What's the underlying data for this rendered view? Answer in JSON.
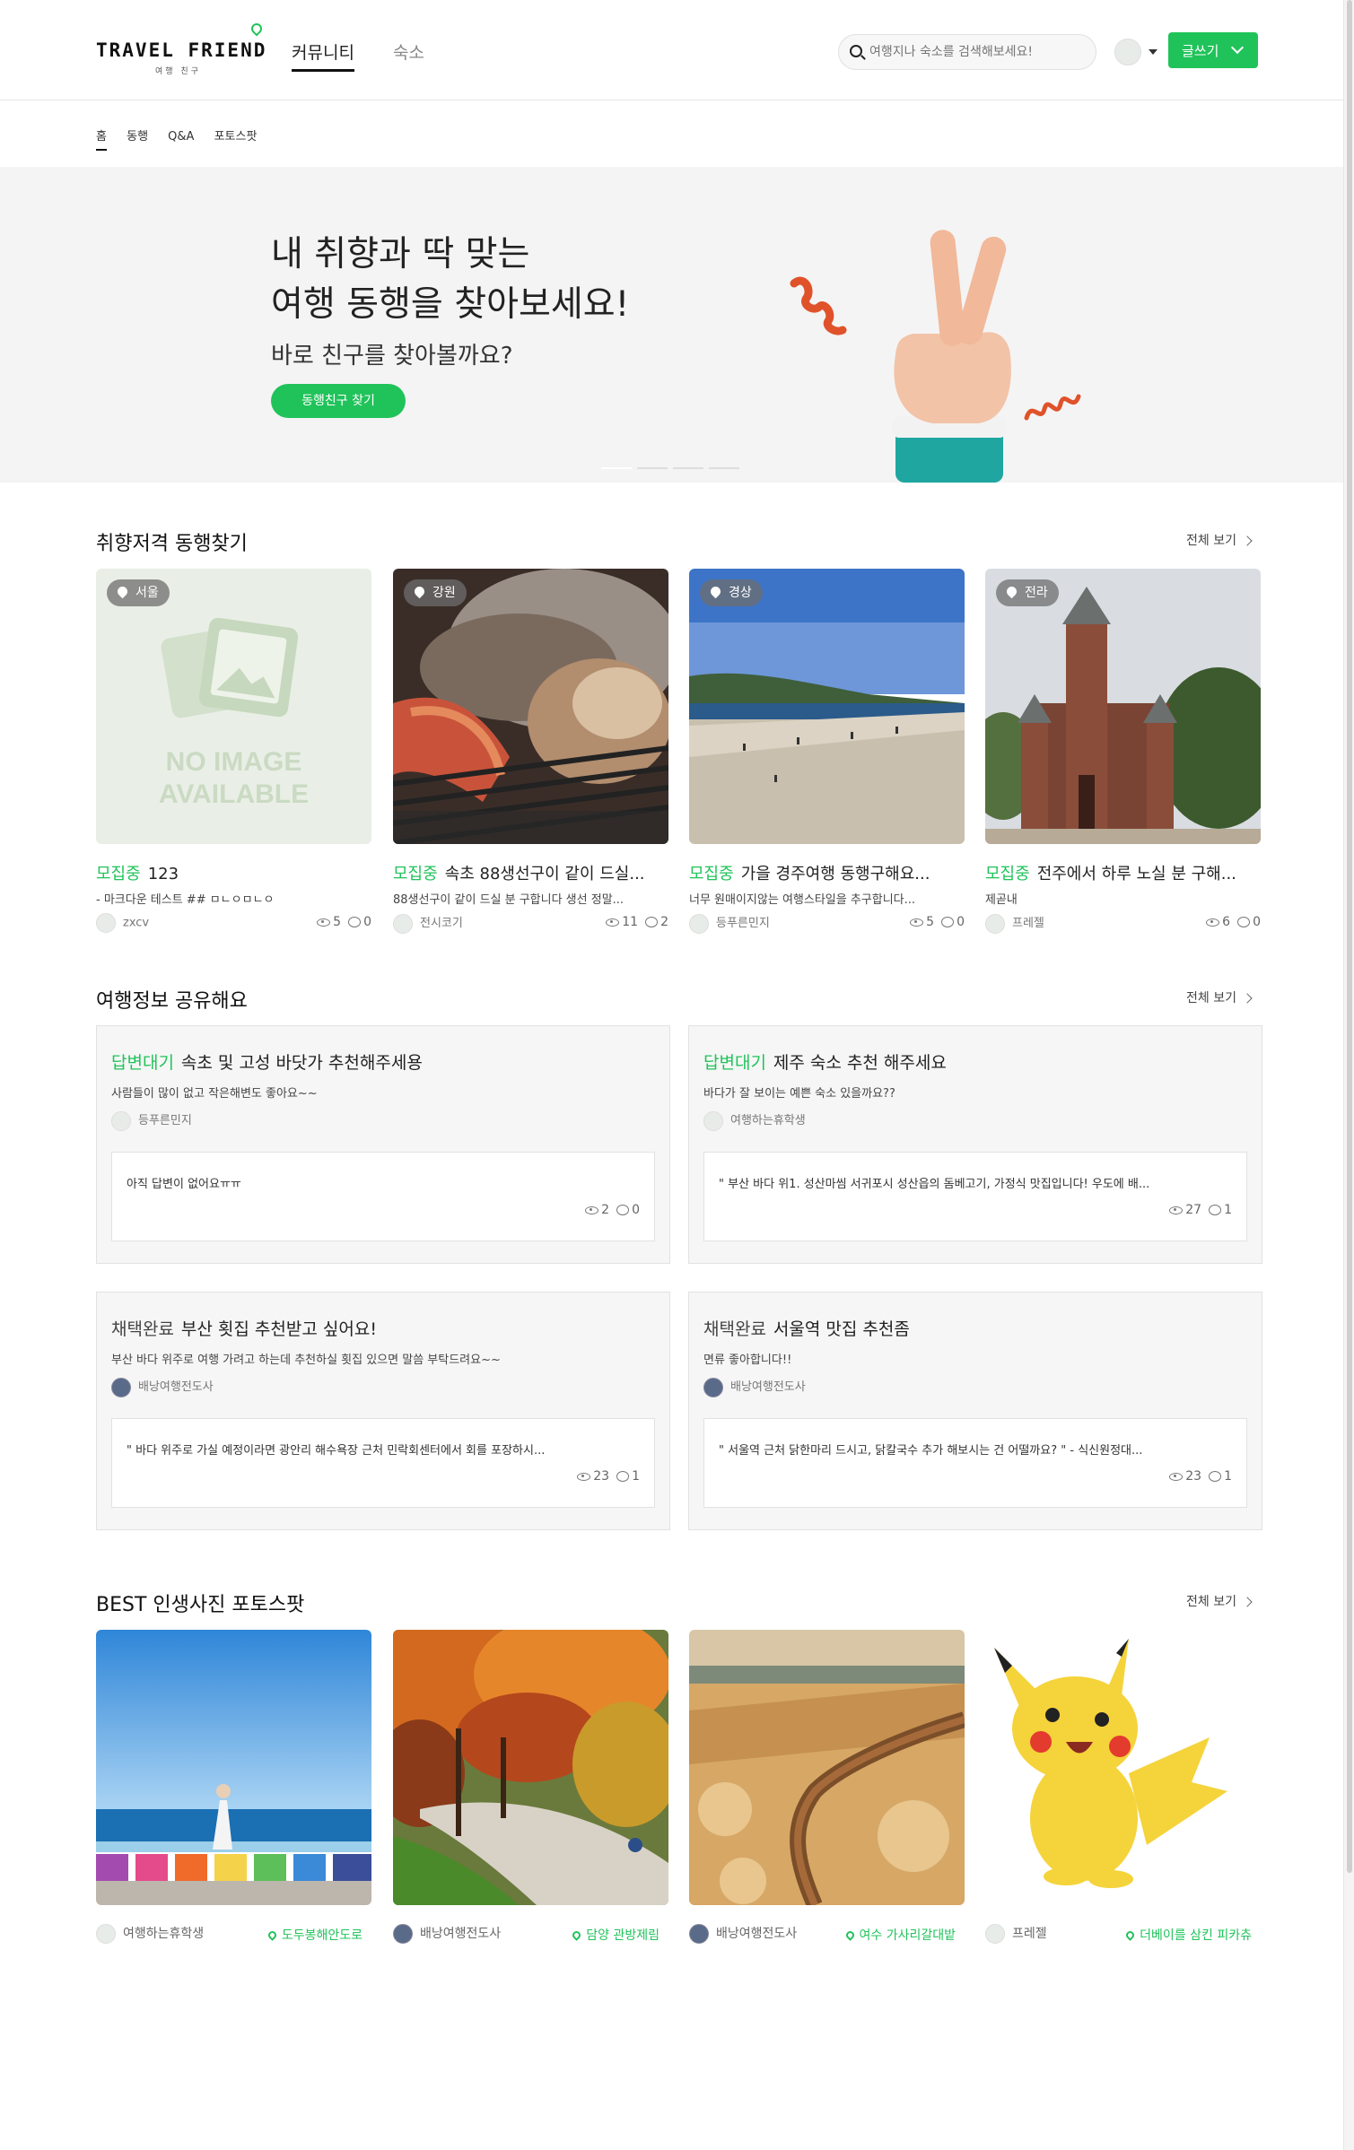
{
  "header": {
    "logo": "TRAVEL FRIEND",
    "logo_sub": "여행 친구",
    "nav": [
      "커뮤니티",
      "숙소"
    ],
    "search_placeholder": "여행지나 숙소를 검색해보세요!",
    "write_label": "글쓰기"
  },
  "subnav": [
    "홈",
    "동행",
    "Q&A",
    "포토스팟"
  ],
  "banner": {
    "line1": "내 취향과 딱 맞는",
    "line2": "여행 동행을 찾아보세요!",
    "line3": "바로 친구를 찾아볼까요?",
    "button": "동행친구 찾기"
  },
  "companion": {
    "title": "취향저격 동행찾기",
    "more": "전체 보기",
    "cards": [
      {
        "region": "서울",
        "status": "모집중",
        "title": "123",
        "desc": "- 마크다운 테스트 ## ㅁㄴㅇㅁㄴㅇ",
        "user": "zxcv",
        "views": "5",
        "comments": "0",
        "no_image": "NO IMAGE AVAILABLE"
      },
      {
        "region": "강원",
        "status": "모집중",
        "title": "속초 88생선구이 같이 드실...",
        "desc": "88생선구이 같이 드실 분 구합니다 생선 정말...",
        "user": "전시코기",
        "views": "11",
        "comments": "2"
      },
      {
        "region": "경상",
        "status": "모집중",
        "title": "가을 경주여행 동행구해요...",
        "desc": "너무 원매이지않는 여행스타일을 추구합니다...",
        "user": "등푸른민지",
        "views": "5",
        "comments": "0"
      },
      {
        "region": "전라",
        "status": "모집중",
        "title": "전주에서 하루 노실 분 구해...",
        "desc": "제곧내",
        "user": "프레젤",
        "views": "6",
        "comments": "0"
      }
    ]
  },
  "qna": {
    "title": "여행정보 공유해요",
    "more": "전체 보기",
    "items": [
      {
        "status": "답변대기",
        "title": "속초 및 고성 바닷가 추천해주세용",
        "desc": "사람들이 많이 없고 작은해변도 좋아요~~",
        "user": "등푸른민지",
        "answer": "아직 답변이 없어요ㅠㅠ",
        "views": "2",
        "comments": "0"
      },
      {
        "status": "답변대기",
        "title": "제주 숙소 추천 해주세요",
        "desc": "바다가 잘 보이는 예쁜 숙소 있을까요??",
        "user": "여행하는휴학생",
        "answer": "\" 부산 바다 위1. 성산마씸 서귀포시 성산읍의 돔베고기, 가정식 맛집입니다! 우도에 배...",
        "views": "27",
        "comments": "1"
      },
      {
        "status": "채택완료",
        "title": "부산 횟집 추천받고 싶어요!",
        "desc": "부산 바다 위주로 여행 가려고 하는데 추천하실 횟집 있으면 말씀 부탁드려요~~",
        "user": "배낭여행전도사",
        "answer": "\" 바다 위주로 가실 예정이라면 광안리 해수욕장 근처 민락회센터에서 회를 포장하시...",
        "views": "23",
        "comments": "1"
      },
      {
        "status": "채택완료",
        "title": "서울역 맛집 추천좀",
        "desc": "면류 좋아합니다!!",
        "user": "배낭여행전도사",
        "answer": "\" 서울역 근처 닭한마리 드시고, 닭칼국수 추가 해보시는 건 어떨까요? \" - 식신원정대...",
        "views": "23",
        "comments": "1"
      }
    ]
  },
  "photos": {
    "title": "BEST 인생사진 포토스팟",
    "more": "전체 보기",
    "items": [
      {
        "user": "여행하는휴학생",
        "place": "도두봉해안도로"
      },
      {
        "user": "배낭여행전도사",
        "place": "담양 관방제림"
      },
      {
        "user": "배낭여행전도사",
        "place": "여수 가사리갈대밭"
      },
      {
        "user": "프레젤",
        "place": "더베이를 삼킨 피카츄"
      }
    ]
  },
  "colors": {
    "brand": "#20c35a"
  }
}
